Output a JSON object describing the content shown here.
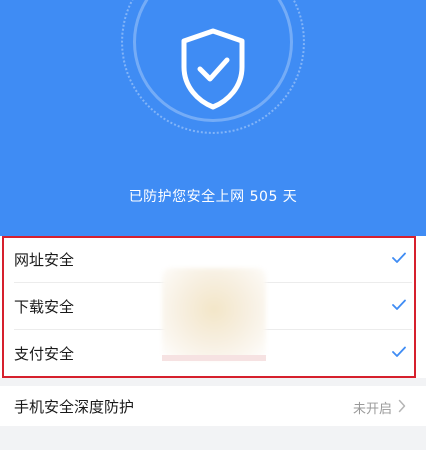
{
  "header": {
    "protect_text": "已防护您安全上网 505 天"
  },
  "security_items": [
    {
      "label": "网址安全",
      "status_icon": "check-icon"
    },
    {
      "label": "下载安全",
      "status_icon": "check-icon"
    },
    {
      "label": "支付安全",
      "status_icon": "check-icon"
    }
  ],
  "deep_protection": {
    "label": "手机安全深度防护",
    "status": "未开启"
  },
  "colors": {
    "hero_bg": "#3f8cf4",
    "check": "#3f8cf4",
    "highlight": "#d6202d"
  }
}
